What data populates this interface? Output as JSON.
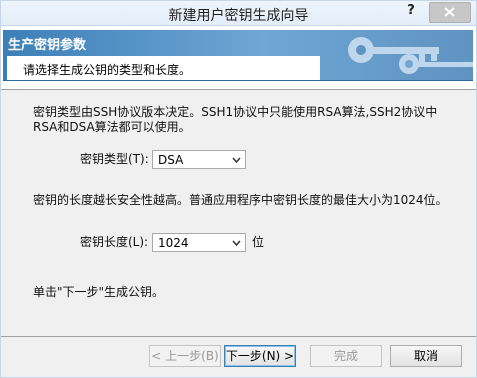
{
  "window": {
    "title": "新建用户密钥生成向导",
    "help_label": "?"
  },
  "header": {
    "title": "生产密钥参数",
    "subtitle": "请选择生成公钥的类型和长度。"
  },
  "content": {
    "description_1": "密钥类型由SSH协议版本决定。SSH1协议中只能使用RSA算法,SSH2协议中RSA和DSA算法都可以使用。",
    "key_type_label": "密钥类型(T):",
    "key_type_value": "DSA",
    "description_2": "密钥的长度越长安全性越高。普通应用程序中密钥长度的最佳大小为1024位。",
    "key_length_label": "密钥长度(L):",
    "key_length_value": "1024",
    "key_length_unit": "位",
    "hint": "单击\"下一步\"生成公钥。"
  },
  "buttons": {
    "back": "< 上一步(B)",
    "next": "下一步(N) >",
    "finish": "完成",
    "cancel": "取消"
  },
  "icons": {
    "help": "help-icon",
    "close": "close-icon",
    "dropdown": "chevron-down-icon",
    "header_art": "keys-icon"
  },
  "colors": {
    "header_band": "#3c7fb8",
    "title_bar": "#e3edf8",
    "close_button": "#c7c7c7"
  }
}
